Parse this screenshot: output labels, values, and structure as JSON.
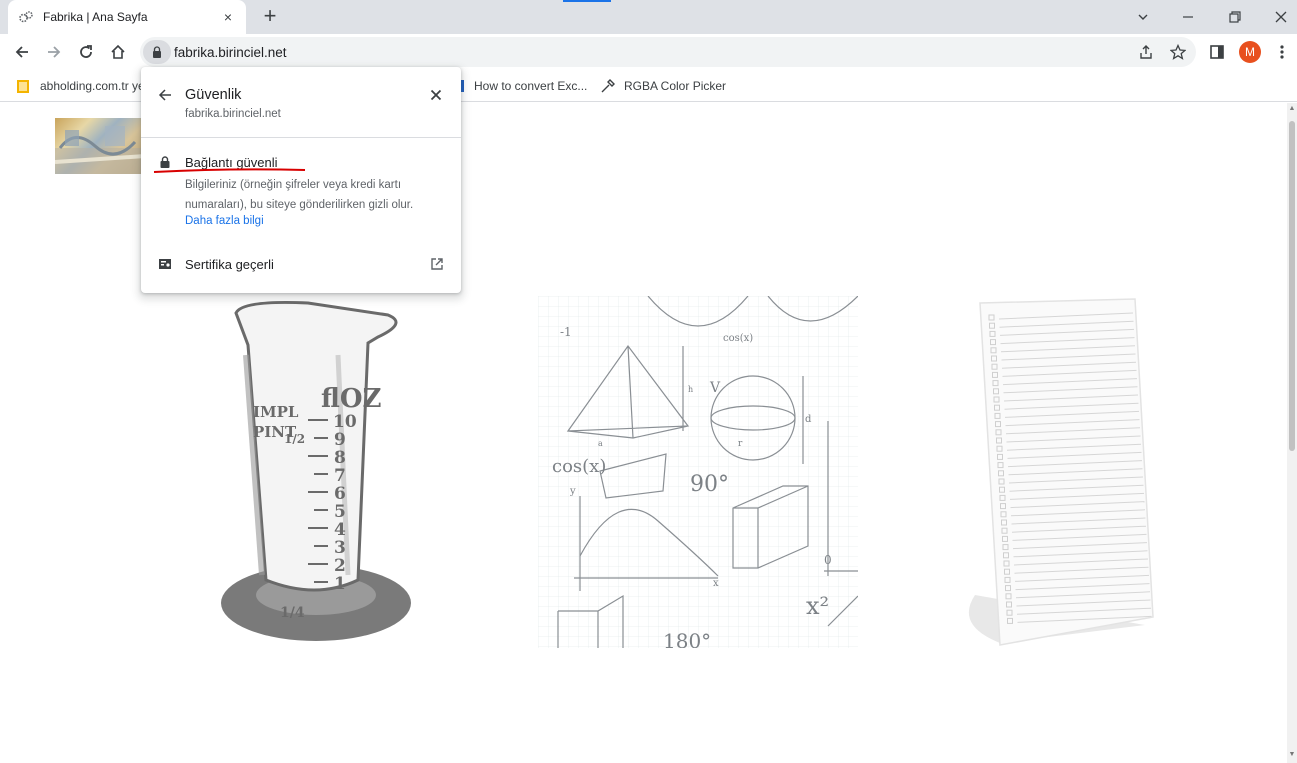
{
  "tab": {
    "title": "Fabrika | Ana Sayfa",
    "favicon": "gears-icon",
    "close": "×"
  },
  "newtab": "+",
  "address": {
    "url": "fabrika.birinciel.net"
  },
  "profile": {
    "initial": "M",
    "color": "#e8501e"
  },
  "bookmarks": [
    {
      "label": "abholding.com.tr ye",
      "icon": "folder-icon"
    },
    {
      "label": "How to convert Exc...",
      "icon": "site-icon"
    },
    {
      "label": "RGBA Color Picker",
      "icon": "eyedropper-icon"
    }
  ],
  "security_popup": {
    "title": "Güvenlik",
    "site": "fabrika.birinciel.net",
    "connection_title": "Bağlantı güvenli",
    "connection_desc": "Bilgileriniz (örneğin şifreler veya kredi kartı numaraları), bu siteye gönderilirken gizli olur.",
    "learn_more": "Daha fazla bilgi",
    "certificate": "Sertifika geçerli",
    "annotation_color": "#d80000"
  },
  "tiles": {
    "beaker": {
      "marks": [
        "flOZ",
        "IMPL",
        "PINT",
        "1/2",
        "1/4",
        "10",
        "9",
        "8",
        "7",
        "6",
        "5",
        "4",
        "3",
        "2",
        "1"
      ]
    },
    "math": {
      "labels": [
        "-1",
        "cos(x)",
        "90°",
        "V",
        "h",
        "d",
        "r",
        "a",
        "x",
        "y",
        "0",
        "x²",
        "180°"
      ]
    }
  },
  "colors": {
    "accent": "#1a73e8",
    "tabstrip": "#dee1e6",
    "omnibox": "#f1f3f4"
  }
}
